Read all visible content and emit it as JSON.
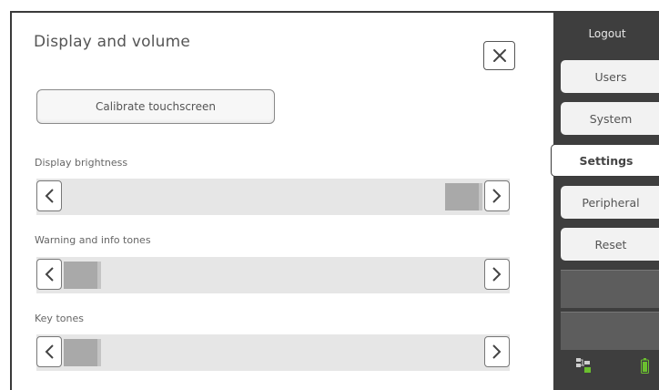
{
  "screen": {
    "title": "Display and volume",
    "calibrate_label": "Calibrate touchscreen"
  },
  "sliders": [
    {
      "label": "Display brightness",
      "level": 1.0
    },
    {
      "label": "Warning and info tones",
      "level": 0.0
    },
    {
      "label": "Key tones",
      "level": 0.0
    }
  ],
  "sidebar": {
    "logout_label": "Logout",
    "tabs": [
      {
        "label": "Users",
        "active": false
      },
      {
        "label": "System",
        "active": false
      },
      {
        "label": "Settings",
        "active": true
      },
      {
        "label": "Peripheral",
        "active": false
      },
      {
        "label": "Reset",
        "active": false
      }
    ]
  },
  "icons": {
    "close": "close-icon",
    "decrease": "chevron-left-icon",
    "increase": "chevron-right-icon",
    "network": "network-status-icon",
    "battery": "battery-icon"
  },
  "colors": {
    "sidebar_bg": "#3e3e3e",
    "status_green": "#6bbf2f",
    "track_bg": "#e6e6e6",
    "thumb": "#a9a9a9"
  }
}
